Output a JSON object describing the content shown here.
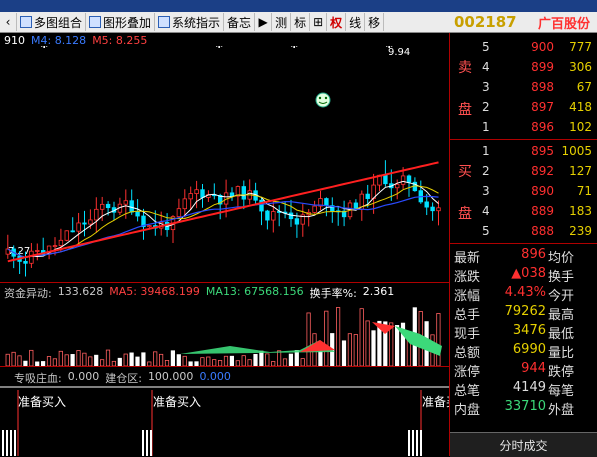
{
  "toolbar": {
    "items": [
      {
        "label": "多图组合"
      },
      {
        "label": "图形叠加"
      },
      {
        "label": "系统指示"
      },
      {
        "label": "备忘"
      },
      {
        "label": "测"
      },
      {
        "label": "标"
      },
      {
        "label": "权"
      },
      {
        "label": "线"
      },
      {
        "label": "移"
      }
    ],
    "play_glyph": "▶",
    "grid_glyph": "⊞"
  },
  "stock": {
    "code": "002187",
    "name": "广百股份"
  },
  "main_chart": {
    "ma_labels": [
      "910",
      "M4: 8.128",
      "M5: 8.255"
    ],
    "high_label": "9.94",
    "low_label": "7.27",
    "colors": {
      "up": "#ff3030",
      "down": "#00e0ff",
      "ma_white": "#ffffff",
      "ma_yellow": "#e6d000",
      "ma_blue": "#2a4bff",
      "ma_red": "#ff2020"
    }
  },
  "volume": {
    "label_title": "资金异动:",
    "label_value": "133.628",
    "ma5_label": "MA5: 39468.199",
    "ma13_label": "MA13: 67568.156",
    "turnover_label": "换手率%:",
    "turnover_value": "2.361"
  },
  "signal": {
    "title": "专吸庄血:",
    "v1": "0.000",
    "label2": "建仓区:",
    "v2": "100.000",
    "v3": "0.000",
    "buy_text": "准备买入"
  },
  "orderbook": {
    "sell_label": [
      "卖",
      "盘"
    ],
    "buy_label": [
      "买",
      "盘"
    ],
    "sell": [
      {
        "level": "5",
        "price": "900",
        "volume": "777"
      },
      {
        "level": "4",
        "price": "899",
        "volume": "306"
      },
      {
        "level": "3",
        "price": "898",
        "volume": "67"
      },
      {
        "level": "2",
        "price": "897",
        "volume": "418"
      },
      {
        "level": "1",
        "price": "896",
        "volume": "102"
      }
    ],
    "buy": [
      {
        "level": "1",
        "price": "895",
        "volume": "1005"
      },
      {
        "level": "2",
        "price": "892",
        "volume": "127"
      },
      {
        "level": "3",
        "price": "890",
        "volume": "71"
      },
      {
        "level": "4",
        "price": "889",
        "volume": "183"
      },
      {
        "level": "5",
        "price": "888",
        "volume": "239"
      }
    ]
  },
  "quote": [
    {
      "l1": "最新",
      "v": "896",
      "vcolor": "#ff3030",
      "l2": "均价"
    },
    {
      "l1": "涨跌",
      "v": "▲038",
      "vcolor": "#ff3030",
      "l2": "换手"
    },
    {
      "l1": "涨幅",
      "v": "4.43%",
      "vcolor": "#ff3030",
      "l2": "今开"
    },
    {
      "l1": "总手",
      "v": "79262",
      "vcolor": "#e6d000",
      "l2": "最高"
    },
    {
      "l1": "现手",
      "v": "3476",
      "vcolor": "#e6d000",
      "l2": "最低"
    },
    {
      "l1": "总额",
      "v": "6990",
      "vcolor": "#e6d000",
      "l2": "量比"
    },
    {
      "l1": "涨停",
      "v": "944",
      "vcolor": "#ff3030",
      "l2": "跌停"
    },
    {
      "l1": "总笔",
      "v": "4149",
      "vcolor": "#dddddd",
      "l2": "每笔"
    },
    {
      "l1": "内盘",
      "v": "33710",
      "vcolor": "#3cd97a",
      "l2": "外盘"
    }
  ],
  "bottom_tab": "分时成交"
}
